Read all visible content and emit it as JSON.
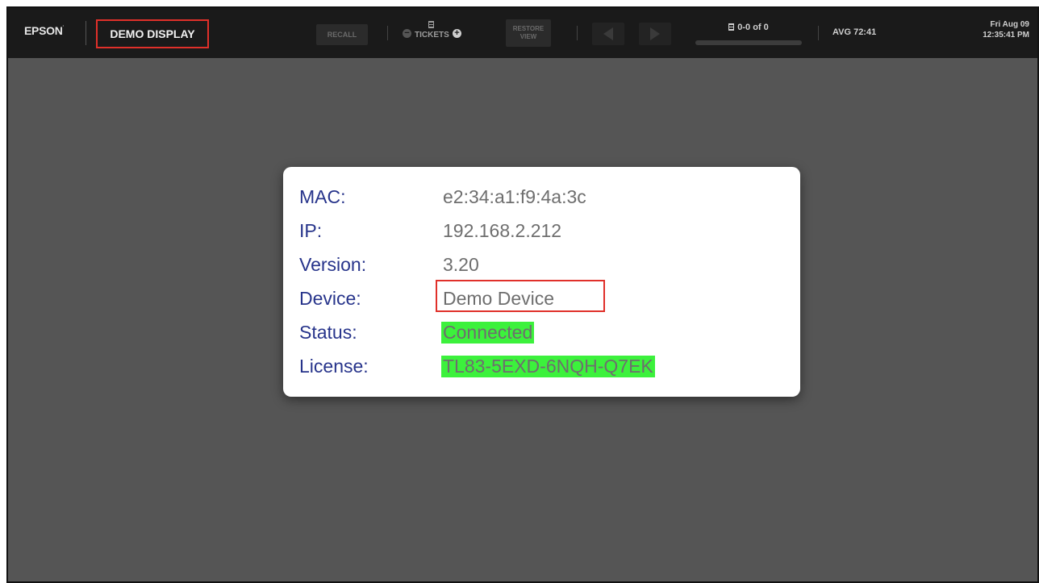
{
  "topbar": {
    "brand": "EPSON",
    "brand_mark": "·",
    "display_name": "DEMO DISPLAY",
    "recall_label": "RECALL",
    "minus_glyph": "−",
    "tickets_label": "TICKETS",
    "plus_glyph": "+",
    "restore_view_label": "RESTORE VIEW",
    "prev_icon": "left-triangle-icon",
    "next_icon": "right-triangle-icon",
    "pager_text": "0-0 of 0",
    "pager_progress": 0,
    "avg_label": "AVG 72:41",
    "clock_date": "Fri Aug 09",
    "clock_time": "12:35:41 PM"
  },
  "dialog": {
    "rows": [
      {
        "label": "MAC:",
        "value": "e2:34:a1:f9:4a:3c"
      },
      {
        "label": "IP:",
        "value": "192.168.2.212"
      },
      {
        "label": "Version:",
        "value": "3.20"
      },
      {
        "label": "Device:",
        "value": "Demo Device"
      },
      {
        "label": "Status:",
        "value": "Connected"
      },
      {
        "label": "License:",
        "value": "TL83-5EXD-6NQH-Q7EK"
      }
    ]
  },
  "colors": {
    "topbar_bg": "#1a1a1a",
    "screen_bg": "#555555",
    "label_blue": "#27348b",
    "value_gray": "#6e6e6e",
    "highlight_green": "#3cf13c",
    "annotation_red": "#e0302a"
  }
}
